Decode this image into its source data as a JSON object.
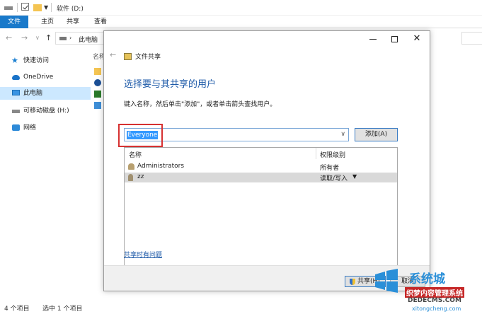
{
  "explorer": {
    "title": "软件 (D:)",
    "ribbon_tabs": [
      "文件",
      "主页",
      "共享",
      "查看"
    ],
    "address": "此电脑",
    "sidebar_items": [
      "快速访问",
      "OneDrive",
      "此电脑",
      "可移动磁盘 (H:)",
      "网络"
    ],
    "column_header": "名称",
    "status_count": "4 个项目",
    "status_selected": "选中 1 个项目"
  },
  "dialog": {
    "app_title": "文件共享",
    "heading": "选择要与其共享的用户",
    "instruction": "键入名称，然后单击\"添加\"，或者单击箭头查找用户。",
    "input_value": "Everyone",
    "add_button": "添加(A)",
    "table": {
      "headers": [
        "名称",
        "权限级别"
      ],
      "rows": [
        {
          "name": "Administrators",
          "permission": "所有者"
        },
        {
          "name": "zz",
          "permission": "读取/写入"
        }
      ]
    },
    "help_link": "共享时有问题",
    "share_button": "共享(H)",
    "cancel_button": "取消"
  },
  "watermark": {
    "brand": "系统城",
    "line1": "织梦内容管理系统",
    "line2": "DEDECMS.COM",
    "line3": "xitongcheng.com"
  },
  "colors": {
    "accent": "#1979ca",
    "heading": "#1e5aa8",
    "highlight": "#d63131",
    "selection": "#3399ff"
  }
}
